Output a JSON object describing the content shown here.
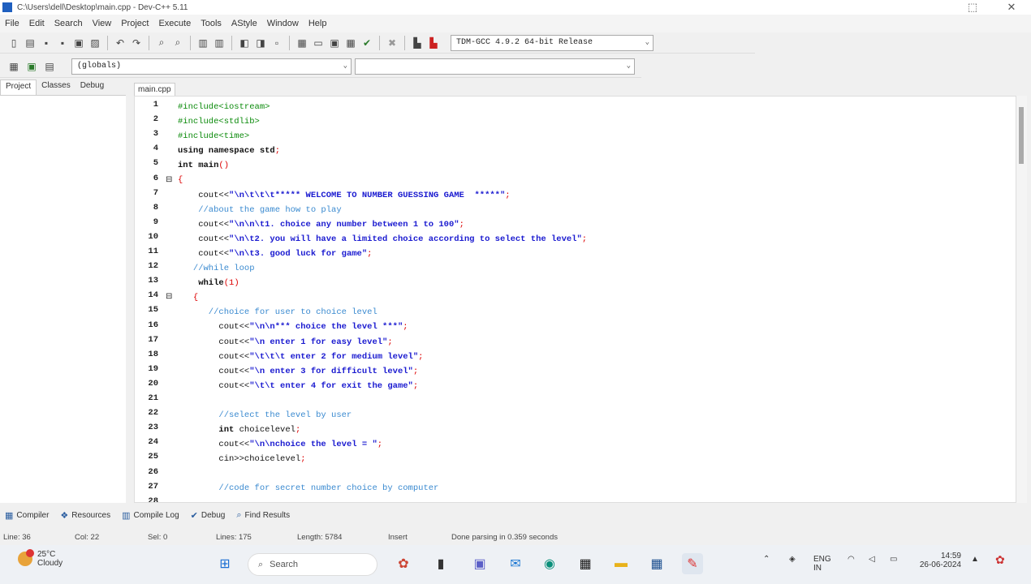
{
  "window": {
    "title": "C:\\Users\\dell\\Desktop\\main.cpp - Dev-C++ 5.11",
    "min_glyph": "⬚",
    "close_glyph": "✕"
  },
  "menu": [
    "File",
    "Edit",
    "Search",
    "View",
    "Project",
    "Execute",
    "Tools",
    "AStyle",
    "Window",
    "Help"
  ],
  "toolbar": {
    "compiler_select": "TDM-GCC 4.9.2 64-bit Release",
    "scope_select": "(globals)",
    "symbol_select": "",
    "arrow": "⌄"
  },
  "left_panel": {
    "tabs": [
      "Project",
      "Classes",
      "Debug"
    ]
  },
  "editor": {
    "tab_label": "main.cpp",
    "lines": [
      {
        "n": "1",
        "fold": "",
        "parts": [
          {
            "t": "#include<iostream>",
            "c": "#0a8a0a"
          }
        ]
      },
      {
        "n": "2",
        "fold": "",
        "parts": [
          {
            "t": "#include<stdlib>",
            "c": "#0a8a0a"
          }
        ]
      },
      {
        "n": "3",
        "fold": "",
        "parts": [
          {
            "t": "#include<time>",
            "c": "#0a8a0a"
          }
        ]
      },
      {
        "n": "4",
        "fold": "",
        "parts": [
          {
            "t": "using namespace std",
            "c": "#111",
            "b": true
          },
          {
            "t": ";",
            "c": "#d00"
          }
        ]
      },
      {
        "n": "5",
        "fold": "",
        "parts": [
          {
            "t": "int main",
            "c": "#111",
            "b": true
          },
          {
            "t": "()",
            "c": "#d00"
          }
        ]
      },
      {
        "n": "6",
        "fold": "⊟",
        "parts": [
          {
            "t": "{",
            "c": "#d00"
          }
        ]
      },
      {
        "n": "7",
        "fold": "",
        "parts": [
          {
            "t": "    cout<<",
            "c": "#111"
          },
          {
            "t": "\"\\n\\t\\t\\t***** WELCOME TO NUMBER GUESSING GAME  *****\"",
            "c": "#1a1ad0",
            "b": true
          },
          {
            "t": ";",
            "c": "#d00"
          }
        ]
      },
      {
        "n": "8",
        "fold": "",
        "parts": [
          {
            "t": "    //about the game how to play",
            "c": "#3a8ad0"
          }
        ]
      },
      {
        "n": "9",
        "fold": "",
        "parts": [
          {
            "t": "    cout<<",
            "c": "#111"
          },
          {
            "t": "\"\\n\\n\\t1. choice any number between 1 to 100\"",
            "c": "#1a1ad0",
            "b": true
          },
          {
            "t": ";",
            "c": "#d00"
          }
        ]
      },
      {
        "n": "10",
        "fold": "",
        "parts": [
          {
            "t": "    cout<<",
            "c": "#111"
          },
          {
            "t": "\"\\n\\t2. you will have a limited choice according to select the level\"",
            "c": "#1a1ad0",
            "b": true
          },
          {
            "t": ";",
            "c": "#d00"
          }
        ]
      },
      {
        "n": "11",
        "fold": "",
        "parts": [
          {
            "t": "    cout<<",
            "c": "#111"
          },
          {
            "t": "\"\\n\\t3. good luck for game\"",
            "c": "#1a1ad0",
            "b": true
          },
          {
            "t": ";",
            "c": "#d00"
          }
        ]
      },
      {
        "n": "12",
        "fold": "",
        "parts": [
          {
            "t": "   //while loop",
            "c": "#3a8ad0"
          }
        ]
      },
      {
        "n": "13",
        "fold": "",
        "parts": [
          {
            "t": "    while",
            "c": "#111",
            "b": true
          },
          {
            "t": "(1)",
            "c": "#d00"
          }
        ]
      },
      {
        "n": "14",
        "fold": "⊟",
        "parts": [
          {
            "t": "   {",
            "c": "#d00"
          }
        ]
      },
      {
        "n": "15",
        "fold": "",
        "parts": [
          {
            "t": "      //choice for user to choice level",
            "c": "#3a8ad0"
          }
        ]
      },
      {
        "n": "16",
        "fold": "",
        "parts": [
          {
            "t": "        cout<<",
            "c": "#111"
          },
          {
            "t": "\"\\n\\n*** choice the level ***\"",
            "c": "#1a1ad0",
            "b": true
          },
          {
            "t": ";",
            "c": "#d00"
          }
        ]
      },
      {
        "n": "17",
        "fold": "",
        "parts": [
          {
            "t": "        cout<<",
            "c": "#111"
          },
          {
            "t": "\"\\n enter 1 for easy level\"",
            "c": "#1a1ad0",
            "b": true
          },
          {
            "t": ";",
            "c": "#d00"
          }
        ]
      },
      {
        "n": "18",
        "fold": "",
        "parts": [
          {
            "t": "        cout<<",
            "c": "#111"
          },
          {
            "t": "\"\\t\\t\\t enter 2 for medium level\"",
            "c": "#1a1ad0",
            "b": true
          },
          {
            "t": ";",
            "c": "#d00"
          }
        ]
      },
      {
        "n": "19",
        "fold": "",
        "parts": [
          {
            "t": "        cout<<",
            "c": "#111"
          },
          {
            "t": "\"\\n enter 3 for difficult level\"",
            "c": "#1a1ad0",
            "b": true
          },
          {
            "t": ";",
            "c": "#d00"
          }
        ]
      },
      {
        "n": "20",
        "fold": "",
        "parts": [
          {
            "t": "        cout<<",
            "c": "#111"
          },
          {
            "t": "\"\\t\\t enter 4 for exit the game\"",
            "c": "#1a1ad0",
            "b": true
          },
          {
            "t": ";",
            "c": "#d00"
          }
        ]
      },
      {
        "n": "21",
        "fold": "",
        "parts": []
      },
      {
        "n": "22",
        "fold": "",
        "parts": [
          {
            "t": "        //select the level by user",
            "c": "#3a8ad0"
          }
        ]
      },
      {
        "n": "23",
        "fold": "",
        "parts": [
          {
            "t": "        int ",
            "c": "#111",
            "b": true
          },
          {
            "t": "choicelevel",
            "c": "#111"
          },
          {
            "t": ";",
            "c": "#d00"
          }
        ]
      },
      {
        "n": "24",
        "fold": "",
        "parts": [
          {
            "t": "        cout<<",
            "c": "#111"
          },
          {
            "t": "\"\\n\\nchoice the level = \"",
            "c": "#1a1ad0",
            "b": true
          },
          {
            "t": ";",
            "c": "#d00"
          }
        ]
      },
      {
        "n": "25",
        "fold": "",
        "parts": [
          {
            "t": "        cin>>choicelevel",
            "c": "#111"
          },
          {
            "t": ";",
            "c": "#d00"
          }
        ]
      },
      {
        "n": "26",
        "fold": "",
        "parts": []
      },
      {
        "n": "27",
        "fold": "",
        "parts": [
          {
            "t": "        //code for secret number choice by computer",
            "c": "#3a8ad0"
          }
        ]
      },
      {
        "n": "28",
        "fold": "",
        "parts": [
          {
            "t": "",
            "c": "#111"
          }
        ]
      }
    ]
  },
  "bottom_tabs": [
    {
      "label": "Compiler",
      "icon": "▦"
    },
    {
      "label": "Resources",
      "icon": "❖"
    },
    {
      "label": "Compile Log",
      "icon": "▥"
    },
    {
      "label": "Debug",
      "icon": "✔"
    },
    {
      "label": "Find Results",
      "icon": "⌕"
    }
  ],
  "status": {
    "line": "Line: 36",
    "col": "Col: 22",
    "sel": "Sel: 0",
    "lines": "Lines: 175",
    "length": "Length: 5784",
    "mode": "Insert",
    "msg": "Done parsing in 0.359 seconds"
  },
  "taskbar": {
    "temp": "25°C",
    "weather": "Cloudy",
    "search_placeholder": "Search",
    "lang": "ENG IN",
    "time": "14:59",
    "date": "26-06-2024"
  }
}
